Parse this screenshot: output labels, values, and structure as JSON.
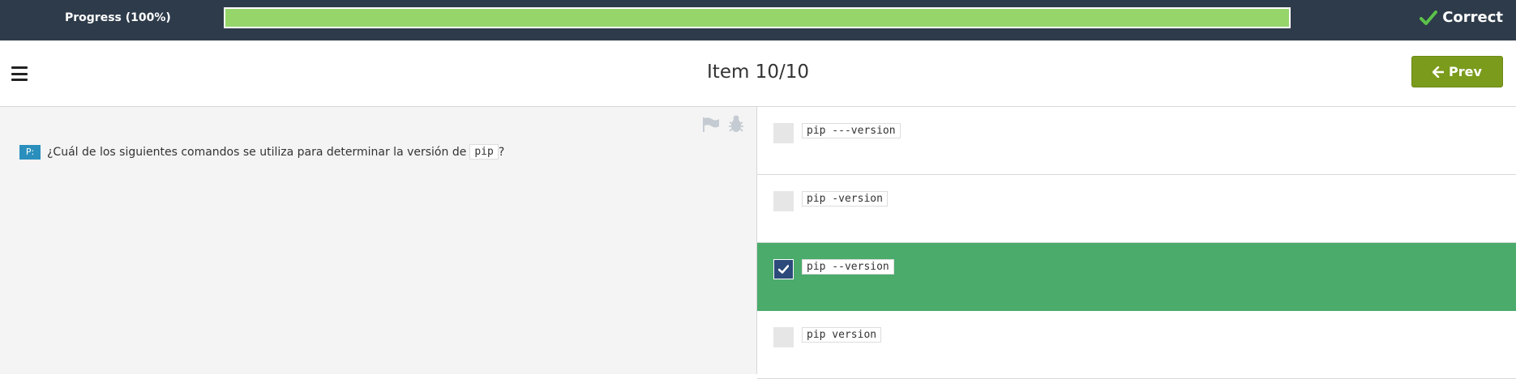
{
  "progress": {
    "label": "Progress (100%)",
    "value": 1.0,
    "fill_color": "#95d56a"
  },
  "status": {
    "label": "Correct",
    "icon": "check-icon"
  },
  "header": {
    "title": "Item 10/10",
    "prev_label": "Prev",
    "menu_icon": "hamburger-menu-icon"
  },
  "question": {
    "badge": "P:",
    "text_before": "¿Cuál de los siguientes comandos se utiliza para determinar la versión de",
    "code": "pip",
    "text_after": "?"
  },
  "options": [
    {
      "text": "pip ---version",
      "selected": false
    },
    {
      "text": "pip -version",
      "selected": false
    },
    {
      "text": "pip --version",
      "selected": true
    },
    {
      "text": "pip version",
      "selected": false
    }
  ],
  "colors": {
    "topbar": "#2e3b4a",
    "accent_green": "#7b9b1c",
    "selected_bg": "#4aab6b",
    "badge_blue": "#2a8fbd"
  }
}
